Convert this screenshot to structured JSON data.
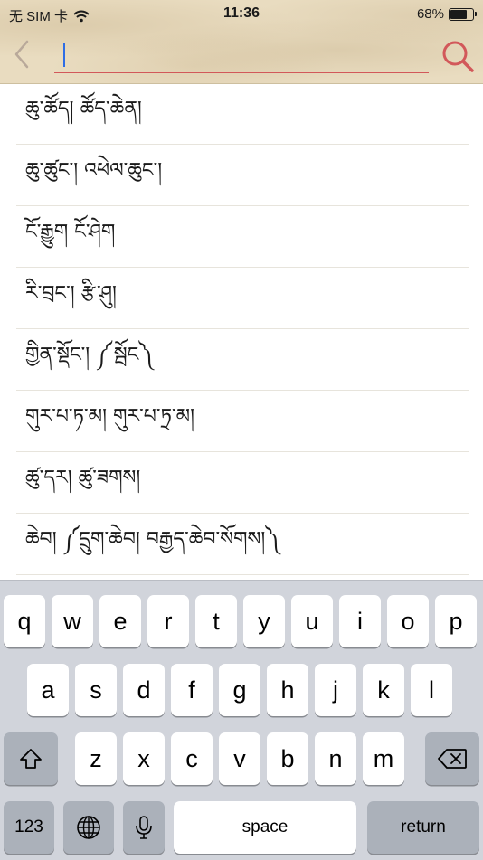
{
  "status_bar": {
    "carrier": "无 SIM 卡",
    "time": "11:36",
    "battery": "68%"
  },
  "header": {
    "search_value": "",
    "search_placeholder": ""
  },
  "results": [
    {
      "text": "ཆུ་ཚོད། ཚོད་ཆེན།"
    },
    {
      "text": "ཆུ་ཚུང་། འཕེལ་ཆུང་།"
    },
    {
      "text": "ངོ་རྒྱུག ངོ་ཤེག"
    },
    {
      "text": "རི་བྲང་། རྩི་ཤུ།"
    },
    {
      "text": "གྱིན་སྡོང་། ༼སྦོང༽"
    },
    {
      "text": "གུར་པ་ཏ་མ། གུར་པ་ཏྲ་མ།"
    },
    {
      "text": "ཚུ་དར། ཚུ་ཟགས།"
    },
    {
      "text": "ཆེབ། ༼དྲུག་ཆེབ། བརྒྱད་ཆེབ་སོགས།༽"
    }
  ],
  "keyboard": {
    "row1": [
      "q",
      "w",
      "e",
      "r",
      "t",
      "y",
      "u",
      "i",
      "o",
      "p"
    ],
    "row2": [
      "a",
      "s",
      "d",
      "f",
      "g",
      "h",
      "j",
      "k",
      "l"
    ],
    "row3": [
      "z",
      "x",
      "c",
      "v",
      "b",
      "n",
      "m"
    ],
    "numbers_label": "123",
    "space_label": "space",
    "return_label": "return"
  },
  "colors": {
    "accent": "#d2585a",
    "caret": "#2e6de5",
    "header_bg": "#e9dcc0",
    "keyboard_bg": "#d1d4db"
  }
}
